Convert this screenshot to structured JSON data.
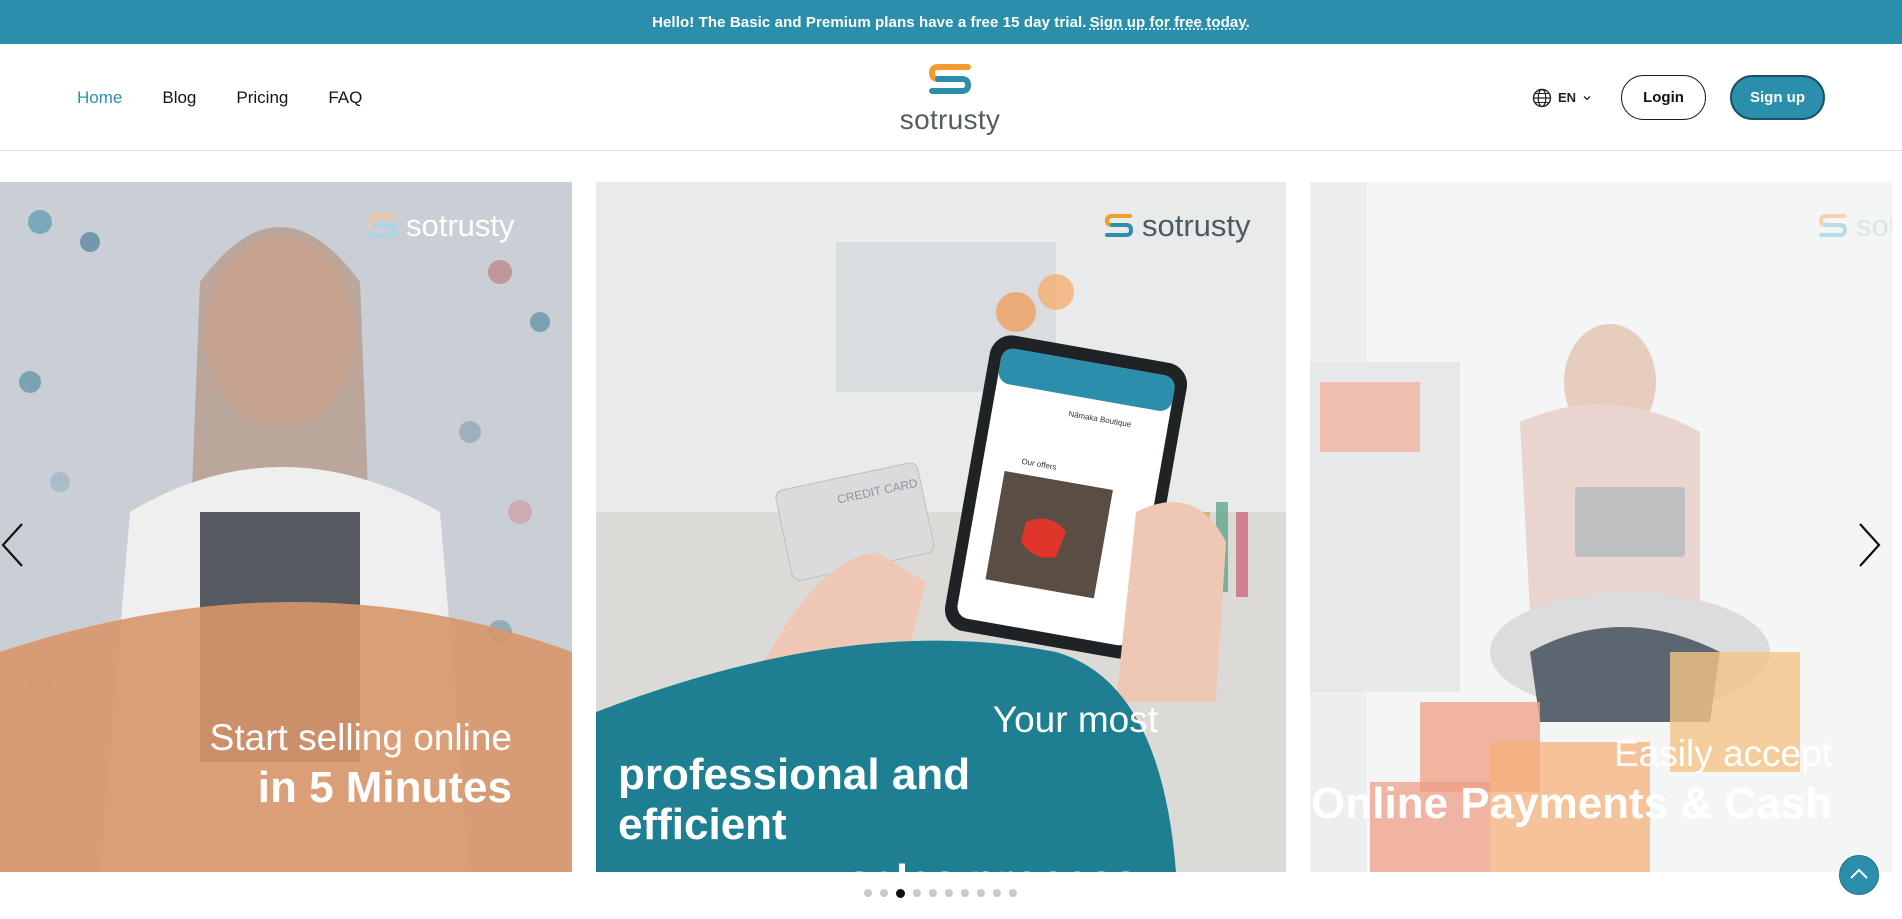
{
  "banner": {
    "text": "Hello! The Basic and Premium plans have a free 15 day trial.",
    "link": "Sign up for free today."
  },
  "nav": {
    "items": [
      {
        "label": "Home",
        "active": true
      },
      {
        "label": "Blog",
        "active": false
      },
      {
        "label": "Pricing",
        "active": false
      },
      {
        "label": "FAQ",
        "active": false
      }
    ]
  },
  "logo": {
    "text": "sotrusty"
  },
  "header_right": {
    "language": "EN",
    "language_icon": "globe-icon",
    "login_label": "Login",
    "signup_label": "Sign up"
  },
  "carousel": {
    "slides": [
      {
        "watermark": "sotrusty",
        "line1": "Start selling online",
        "line2": "in 5 Minutes"
      },
      {
        "watermark": "sotrusty",
        "line1": "Your most",
        "line2": "professional and efficient",
        "line3": "sales process",
        "phone": {
          "shop_name": "Nâmaka Boutique",
          "section": "Our offers"
        },
        "card_text": "CREDIT CARD"
      },
      {
        "watermark": "sotrusty",
        "line1": "Easily accept",
        "line2": "Online Payments & Cash"
      }
    ],
    "prev_icon": "chevron-left-icon",
    "next_icon": "chevron-right-icon",
    "dot_count": 10,
    "active_dot": 2
  },
  "colors": {
    "brand": "#2b8fac",
    "logo_orange": "#f29a2e",
    "text_dark": "#151515"
  },
  "scroll_top_icon": "chevron-up-icon"
}
